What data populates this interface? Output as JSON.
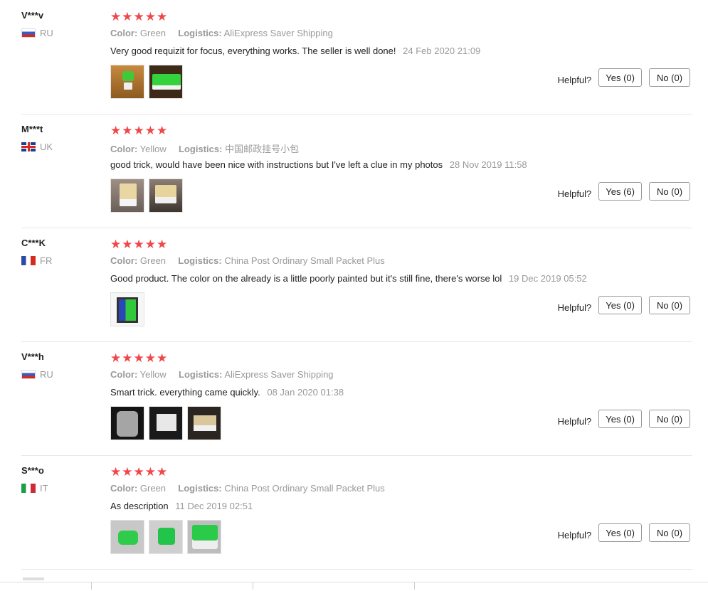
{
  "helpful_label": "Helpful?",
  "colors": {
    "star": "#f0474a",
    "muted": "#999999",
    "border": "#e8e8e8"
  },
  "reviews": [
    {
      "name": "V***v",
      "country": "RU",
      "flag": "flag-ru",
      "flag_icon": "russia-flag-icon",
      "stars": "★★★★★",
      "rating": 5,
      "color_label": "Color:",
      "color": "Green",
      "logistics_label": "Logistics:",
      "logistics": "AliExpress Saver Shipping",
      "text": "Very good requizit for focus, everything works. The seller is well done!",
      "date": "24 Feb 2020 21:09",
      "photos": [
        "ph-green-wood",
        "ph-green-box"
      ],
      "yes": "Yes (0)",
      "no": "No (0)"
    },
    {
      "name": "M***t",
      "country": "UK",
      "flag": "flag-uk",
      "flag_icon": "uk-flag-icon",
      "stars": "★★★★★",
      "rating": 5,
      "color_label": "Color:",
      "color": "Yellow",
      "logistics_label": "Logistics:",
      "logistics": "中国邮政挂号小包",
      "text": "good trick, would have been nice with instructions but I've left a clue in my photos",
      "date": "28 Nov 2019 11:58",
      "photos": [
        "ph-yellow-a",
        "ph-yellow-b"
      ],
      "yes": "Yes (6)",
      "no": "No (0)"
    },
    {
      "name": "C***K",
      "country": "FR",
      "flag": "flag-fr",
      "flag_icon": "france-flag-icon",
      "stars": "★★★★★",
      "rating": 5,
      "color_label": "Color:",
      "color": "Green",
      "logistics_label": "Logistics:",
      "logistics": "China Post Ordinary Small Packet Plus",
      "text": "Good product. The color on the already is a little poorly painted but it's still fine, there's worse lol",
      "date": "19 Dec 2019 05:52",
      "photos": [
        "ph-green-dark"
      ],
      "yes": "Yes (0)",
      "no": "No (0)"
    },
    {
      "name": "V***h",
      "country": "RU",
      "flag": "flag-ru",
      "flag_icon": "russia-flag-icon",
      "stars": "★★★★★",
      "rating": 5,
      "color_label": "Color:",
      "color": "Yellow",
      "logistics_label": "Logistics:",
      "logistics": "AliExpress Saver Shipping",
      "text": "Smart trick. everything came quickly.",
      "date": "08 Jan 2020 01:38",
      "photos": [
        "ph-pkg-1",
        "ph-pkg-2",
        "ph-pkg-3"
      ],
      "yes": "Yes (0)",
      "no": "No (0)"
    },
    {
      "name": "S***o",
      "country": "IT",
      "flag": "flag-it",
      "flag_icon": "italy-flag-icon",
      "stars": "★★★★★",
      "rating": 5,
      "color_label": "Color:",
      "color": "Green",
      "logistics_label": "Logistics:",
      "logistics": "China Post Ordinary Small Packet Plus",
      "text": "As description",
      "date": "11 Dec 2019 02:51",
      "photos": [
        "ph-green-hand",
        "ph-green-hand2",
        "ph-green-open"
      ],
      "yes": "Yes (0)",
      "no": "No (0)"
    }
  ]
}
